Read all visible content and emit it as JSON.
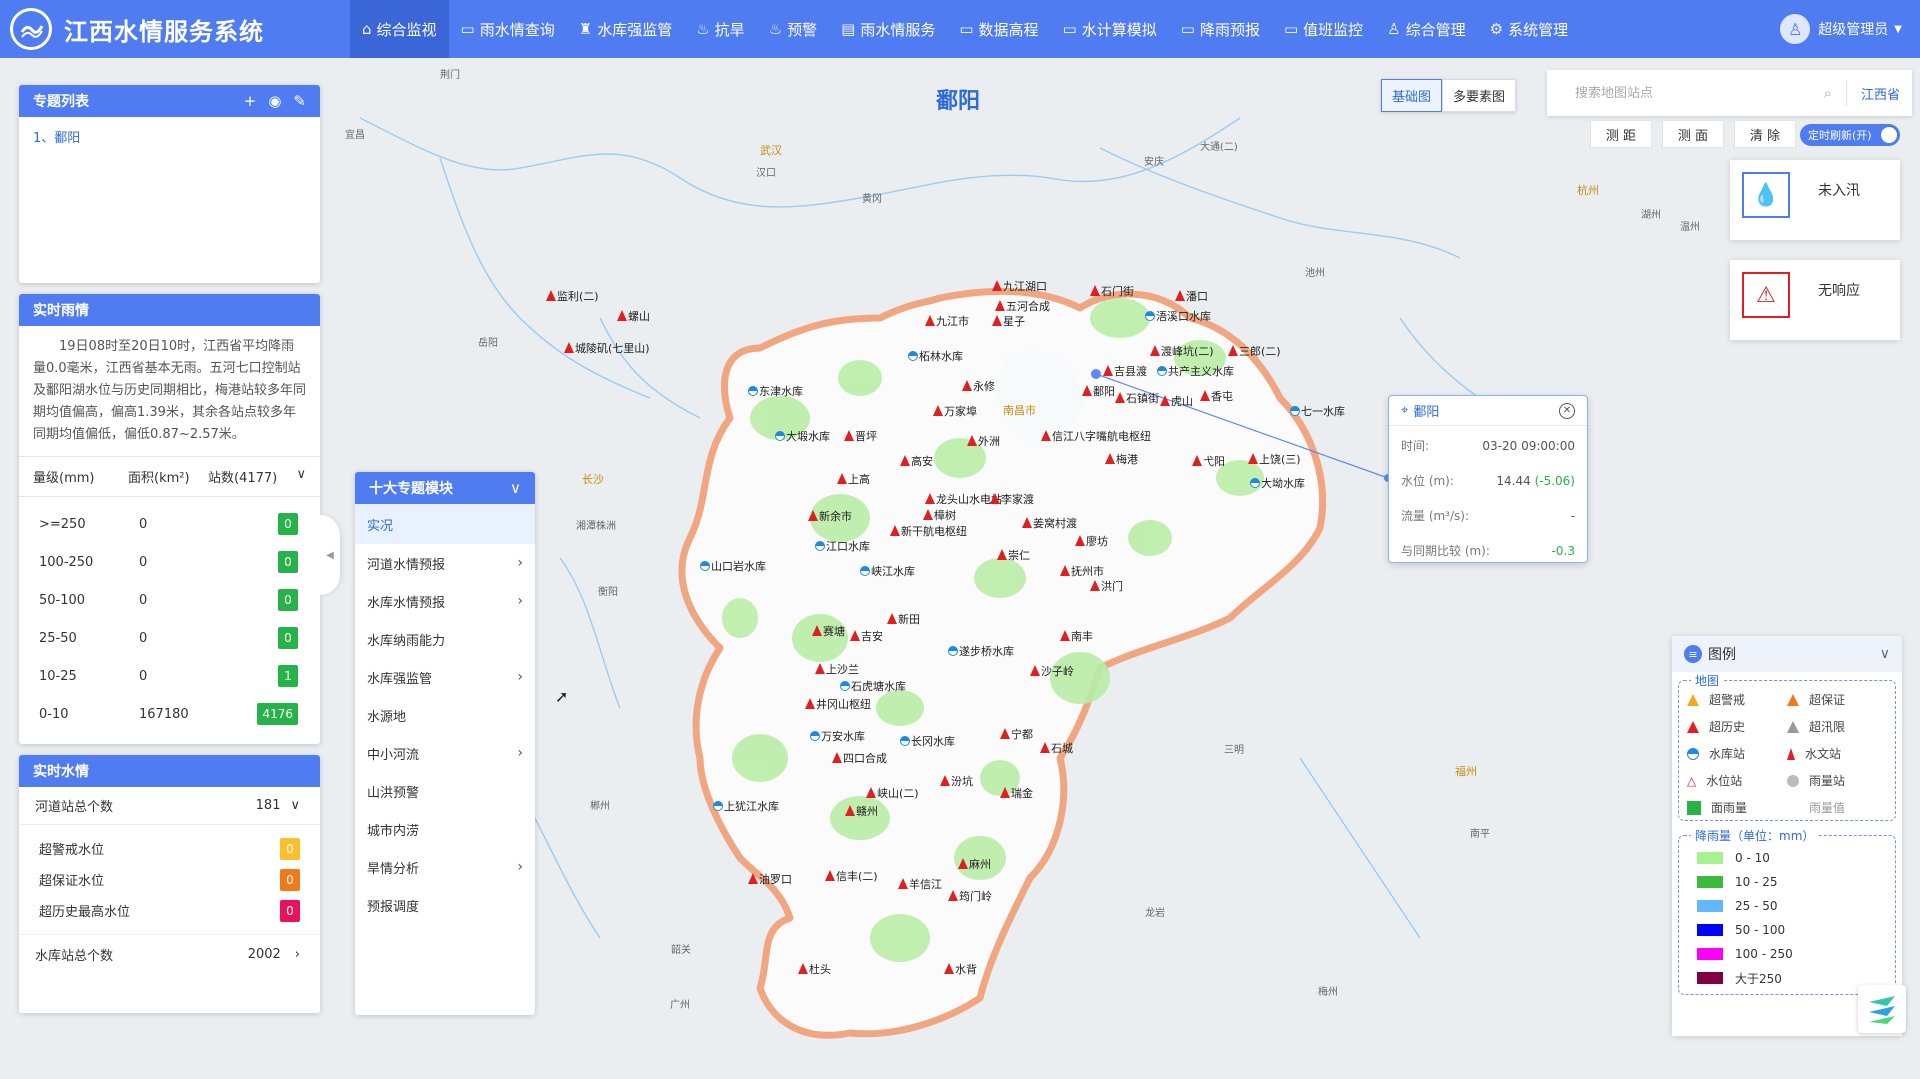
{
  "app": {
    "title": "江西水情服务系统",
    "user": "超级管理员"
  },
  "nav": [
    {
      "label": "综合监视",
      "icon": "⌂"
    },
    {
      "label": "雨水情查询",
      "icon": "▭"
    },
    {
      "label": "水库强监管",
      "icon": "♜"
    },
    {
      "label": "抗旱",
      "icon": "♨"
    },
    {
      "label": "预警",
      "icon": "♨"
    },
    {
      "label": "雨水情服务",
      "icon": "▤"
    },
    {
      "label": "数据高程",
      "icon": "▭"
    },
    {
      "label": "水计算模拟",
      "icon": "▭"
    },
    {
      "label": "降雨预报",
      "icon": "▭"
    },
    {
      "label": "值班监控",
      "icon": "▭"
    },
    {
      "label": "综合管理",
      "icon": "♙"
    },
    {
      "label": "系统管理",
      "icon": "⚙"
    }
  ],
  "topic_list": {
    "title": "专题列表",
    "items": [
      "1、鄱阳"
    ]
  },
  "rain": {
    "title": "实时雨情",
    "summary": "19日08时至20日10时，江西省平均降雨量0.0毫米，江西省基本无雨。五河七口控制站及鄱阳湖水位与历史同期相比，梅港站较多年同期均值偏高，偏高1.39米，其余各站点较多年同期均值偏低，偏低0.87~2.57米。",
    "col_level": "量级(mm)",
    "col_area": "面积(km²)",
    "col_count": "站数(4177)",
    "rows": [
      {
        "level": ">=250",
        "area": "0",
        "count": "0"
      },
      {
        "level": "100-250",
        "area": "0",
        "count": "0"
      },
      {
        "level": "50-100",
        "area": "0",
        "count": "0"
      },
      {
        "level": "25-50",
        "area": "0",
        "count": "0"
      },
      {
        "level": "10-25",
        "area": "0",
        "count": "1"
      },
      {
        "level": "0-10",
        "area": "167180",
        "count": "4176"
      }
    ]
  },
  "water": {
    "title": "实时水情",
    "river_label": "河道站总个数",
    "river_count": "181",
    "items": [
      {
        "label": "超警戒水位",
        "value": "0",
        "color": "#f7c02c"
      },
      {
        "label": "超保证水位",
        "value": "0",
        "color": "#f07a1b"
      },
      {
        "label": "超历史最高水位",
        "value": "0",
        "color": "#e8115a"
      }
    ],
    "reservoir_label": "水库站总个数",
    "reservoir_count": "2002"
  },
  "modules": {
    "title": "十大专题模块",
    "items": [
      {
        "label": "实况",
        "has_sub": false
      },
      {
        "label": "河道水情预报",
        "has_sub": true
      },
      {
        "label": "水库水情预报",
        "has_sub": true
      },
      {
        "label": "水库纳雨能力",
        "has_sub": false
      },
      {
        "label": "水库强监管",
        "has_sub": true
      },
      {
        "label": "水源地",
        "has_sub": false
      },
      {
        "label": "中小河流",
        "has_sub": true
      },
      {
        "label": "山洪预警",
        "has_sub": false
      },
      {
        "label": "城市内涝",
        "has_sub": false
      },
      {
        "label": "旱情分析",
        "has_sub": true
      },
      {
        "label": "预报调度",
        "has_sub": false
      }
    ]
  },
  "map": {
    "title": "鄱阳",
    "basemap_options": [
      "基础图",
      "多要素图"
    ],
    "search_placeholder": "搜索地图站点",
    "region": "江西省",
    "tools": [
      "测 距",
      "测 面",
      "清 除"
    ],
    "refresh_label": "定时刷新(开)",
    "status_cards": [
      {
        "label": "未入汛",
        "icon": "drop-icon",
        "color": "#4f7cf0"
      },
      {
        "label": "无响应",
        "icon": "alarm-icon",
        "color": "#e02020"
      }
    ],
    "places": [
      {
        "t": "荆门"
      },
      {
        "t": "宜昌"
      },
      {
        "t": "武汉"
      },
      {
        "t": "汉口"
      },
      {
        "t": "黄冈"
      },
      {
        "t": "安庆"
      },
      {
        "t": "大通(二)"
      },
      {
        "t": "池州"
      },
      {
        "t": "杭州"
      },
      {
        "t": "湖州"
      },
      {
        "t": "长沙"
      },
      {
        "t": "株洲"
      },
      {
        "t": "湘潭"
      },
      {
        "t": "岳阳"
      },
      {
        "t": "衡阳"
      },
      {
        "t": "郴州"
      },
      {
        "t": "三明"
      },
      {
        "t": "福州"
      },
      {
        "t": "南平"
      },
      {
        "t": "龙岩"
      },
      {
        "t": "梅州"
      },
      {
        "t": "广州"
      },
      {
        "t": "韶关"
      },
      {
        "t": "南昌市"
      },
      {
        "t": "温州"
      }
    ],
    "stations": [
      {
        "t": "九江湖口"
      },
      {
        "t": "星子"
      },
      {
        "t": "五河合成"
      },
      {
        "t": "九江市"
      },
      {
        "t": "石门街"
      },
      {
        "t": "潘口"
      },
      {
        "t": "浯溪口水库"
      },
      {
        "t": "渡峰坑(二)"
      },
      {
        "t": "三郎(二)"
      },
      {
        "t": "共产主义水库"
      },
      {
        "t": "柘林水库"
      },
      {
        "t": "永修"
      },
      {
        "t": "鄱阳"
      },
      {
        "t": "吉县渡"
      },
      {
        "t": "石镇街"
      },
      {
        "t": "虎山"
      },
      {
        "t": "香屯"
      },
      {
        "t": "七一水库"
      },
      {
        "t": "东津水库"
      },
      {
        "t": "万家埠"
      },
      {
        "t": "大塅水库"
      },
      {
        "t": "晋坪"
      },
      {
        "t": "外洲"
      },
      {
        "t": "信江八字嘴航电枢纽"
      },
      {
        "t": "梅港"
      },
      {
        "t": "弋阳"
      },
      {
        "t": "上饶(三)"
      },
      {
        "t": "大坳水库"
      },
      {
        "t": "高安"
      },
      {
        "t": "上高"
      },
      {
        "t": "龙头山水电站"
      },
      {
        "t": "李家渡"
      },
      {
        "t": "樟树"
      },
      {
        "t": "新干航电枢纽"
      },
      {
        "t": "姜窝村渡"
      },
      {
        "t": "新余市"
      },
      {
        "t": "江口水库"
      },
      {
        "t": "崇仁"
      },
      {
        "t": "廖坊"
      },
      {
        "t": "山口岩水库"
      },
      {
        "t": "峡江水库"
      },
      {
        "t": "抚州市"
      },
      {
        "t": "洪门"
      },
      {
        "t": "新田"
      },
      {
        "t": "赛塘"
      },
      {
        "t": "吉安"
      },
      {
        "t": "南丰"
      },
      {
        "t": "上沙兰"
      },
      {
        "t": "石虎塘水库"
      },
      {
        "t": "遂步桥水库"
      },
      {
        "t": "沙子岭"
      },
      {
        "t": "井冈山枢纽"
      },
      {
        "t": "万安水库"
      },
      {
        "t": "四口合成"
      },
      {
        "t": "长冈水库"
      },
      {
        "t": "宁都"
      },
      {
        "t": "石城"
      },
      {
        "t": "上犹江水库"
      },
      {
        "t": "峡山(二)"
      },
      {
        "t": "赣州"
      },
      {
        "t": "汾坑"
      },
      {
        "t": "瑞金"
      },
      {
        "t": "油罗口"
      },
      {
        "t": "信丰(二)"
      },
      {
        "t": "羊信江"
      },
      {
        "t": "麻州"
      },
      {
        "t": "筠门岭"
      },
      {
        "t": "杜头"
      },
      {
        "t": "水背"
      },
      {
        "t": "监利(二)"
      },
      {
        "t": "螺山"
      },
      {
        "t": "城陵矶(七里山)"
      }
    ]
  },
  "popup": {
    "title": "鄱阳",
    "rows": [
      {
        "label": "时间:",
        "value": "03-20 09:00:00",
        "extra": ""
      },
      {
        "label": "水位 (m):",
        "value": "14.44",
        "extra": "(-5.06)"
      },
      {
        "label": "流量 (m³/s):",
        "value": "-",
        "extra": ""
      },
      {
        "label": "与同期比较 (m):",
        "value": "",
        "extra": "-0.3"
      }
    ]
  },
  "legend": {
    "title": "图例",
    "map_caption": "地图",
    "items": [
      {
        "label": "超警戒",
        "icon": "warning-triangle-icon",
        "color": "#f5a623"
      },
      {
        "label": "超保证",
        "icon": "warning-triangle-icon",
        "color": "#f07a1b"
      },
      {
        "label": "超历史",
        "icon": "warning-triangle-icon",
        "color": "#e02020"
      },
      {
        "label": "超汛限",
        "icon": "warning-triangle-icon",
        "color": "#999999"
      },
      {
        "label": "水库站",
        "icon": "reservoir-icon",
        "color": "#1e88e5"
      },
      {
        "label": "水文站",
        "icon": "hydrology-station-icon",
        "color": "#e02020"
      },
      {
        "label": "水位站",
        "icon": "water-level-icon",
        "color": "#e02020"
      },
      {
        "label": "雨量站",
        "icon": "rain-station-icon",
        "color": "#bbbbbb"
      },
      {
        "label": "面雨量",
        "icon": "area-rain-icon",
        "color": "#25b34a"
      },
      {
        "label": "雨量值",
        "icon": "",
        "color": ""
      }
    ],
    "rain_caption": "降雨量（单位：mm）",
    "scale": [
      {
        "label": "0 - 10",
        "color": "#a6f28f"
      },
      {
        "label": "10 - 25",
        "color": "#3dba3d"
      },
      {
        "label": "25 - 50",
        "color": "#61b8ff"
      },
      {
        "label": "50 - 100",
        "color": "#0000ff"
      },
      {
        "label": "100 - 250",
        "color": "#fa00fa"
      },
      {
        "label": "大于250",
        "color": "#800040"
      }
    ]
  }
}
